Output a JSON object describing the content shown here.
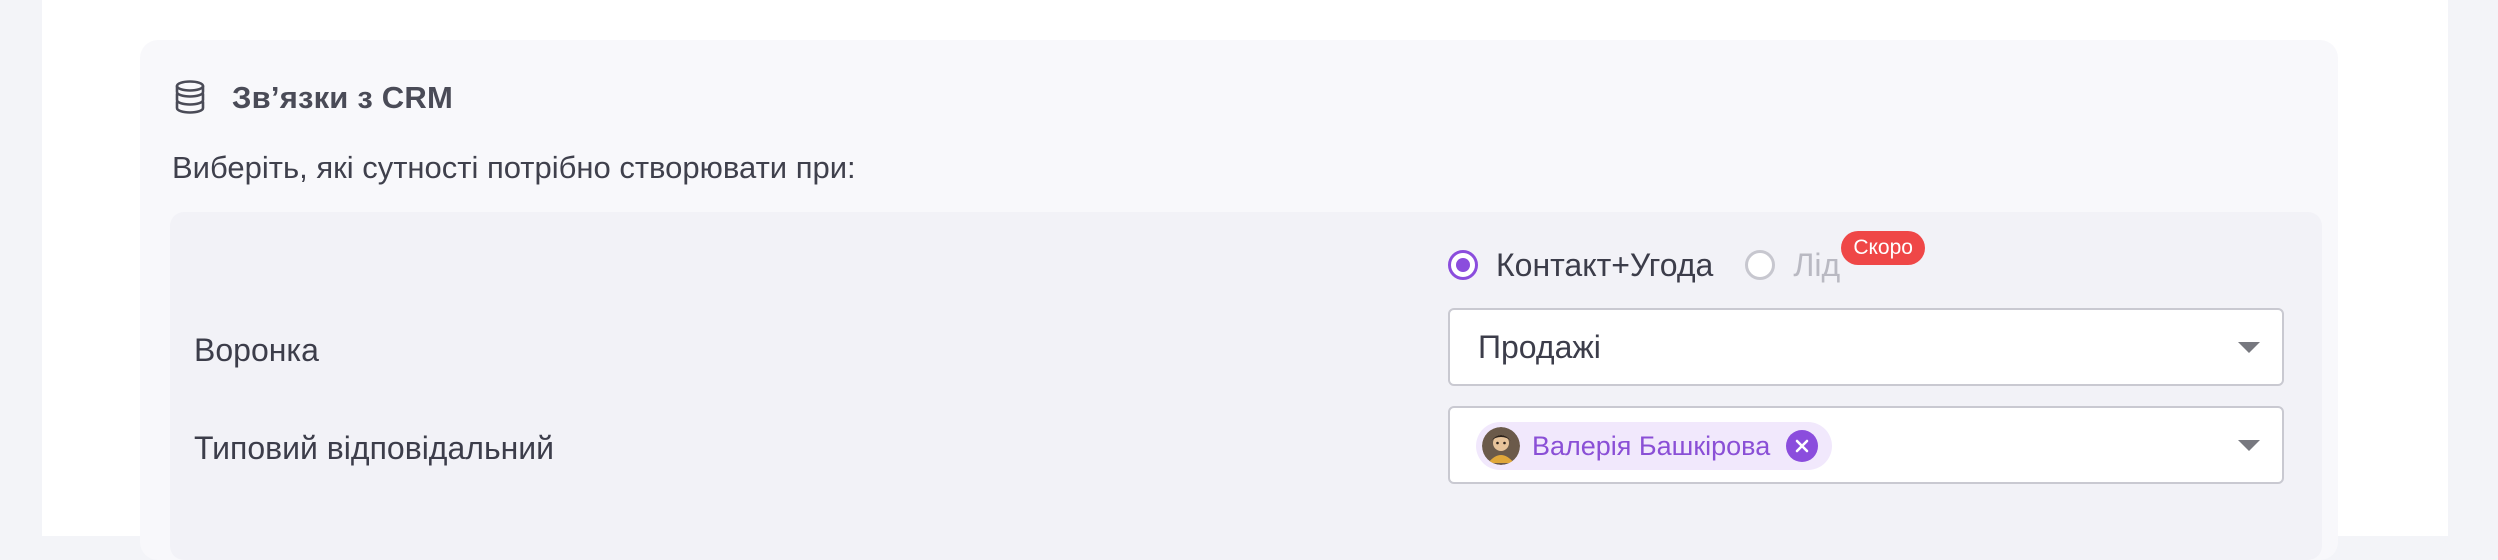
{
  "section": {
    "icon": "database-icon",
    "title": "Зв’язки з CRM",
    "subtitle": "Виберіть, які сутності потрібно створювати при:"
  },
  "entity_type": {
    "options": [
      {
        "label": "Контакт+Угода",
        "selected": true,
        "disabled": false
      },
      {
        "label": "Лід",
        "selected": false,
        "disabled": true,
        "badge": "Скоро"
      }
    ]
  },
  "pipeline": {
    "label": "Воронка",
    "value": "Продажі"
  },
  "responsible": {
    "label": "Типовий відповідальний",
    "chip": {
      "name": "Валерія Башкірова",
      "avatar_icon": "user-avatar-icon",
      "remove_icon": "close-icon"
    }
  },
  "colors": {
    "accent": "#8b4ddd",
    "badge": "#ef4747",
    "chip_bg": "#f1e8fc"
  }
}
